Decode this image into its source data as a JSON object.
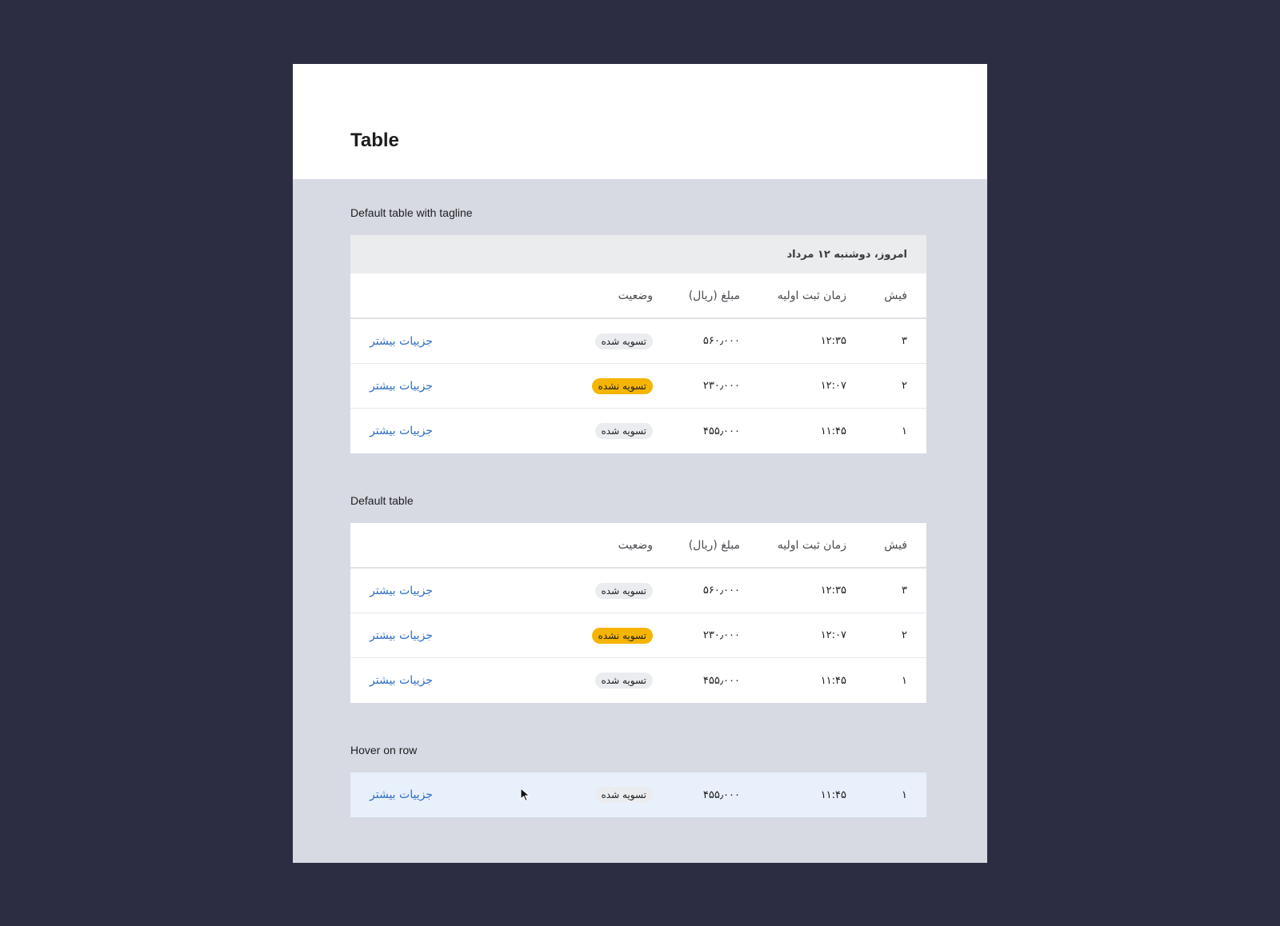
{
  "page": {
    "title": "Table"
  },
  "sections": {
    "tagline_table": {
      "label": "Default table with tagline",
      "tagline": "امروز، دوشنبه ۱۲ مرداد"
    },
    "default_table": {
      "label": "Default table"
    },
    "hover_table": {
      "label": "Hover on row"
    }
  },
  "columns": {
    "receipt": "فیش",
    "time": "زمان ثبت اولیه",
    "amount": "مبلغ (ریال)",
    "status": "وضعیت"
  },
  "rows": [
    {
      "receipt": "۳",
      "time": "۱۲:۳۵",
      "amount": "۵۶۰٫۰۰۰",
      "status": "تسویه شده",
      "link": "جزییات بیشتر"
    },
    {
      "receipt": "۲",
      "time": "۱۲:۰۷",
      "amount": "۲۳۰٫۰۰۰",
      "status": "تسویه نشده",
      "link": "جزییات بیشتر"
    },
    {
      "receipt": "۱",
      "time": "۱۱:۴۵",
      "amount": "۴۵۵٫۰۰۰",
      "status": "تسویه شده",
      "link": "جزییات بیشتر"
    }
  ],
  "colors": {
    "background": "#2c2d42",
    "panel": "#d7dae3",
    "link": "#2a6cc4",
    "badge_unsettled": "#f5b400",
    "badge_settled": "#ebecef",
    "hover_row": "#e8f0fb"
  }
}
